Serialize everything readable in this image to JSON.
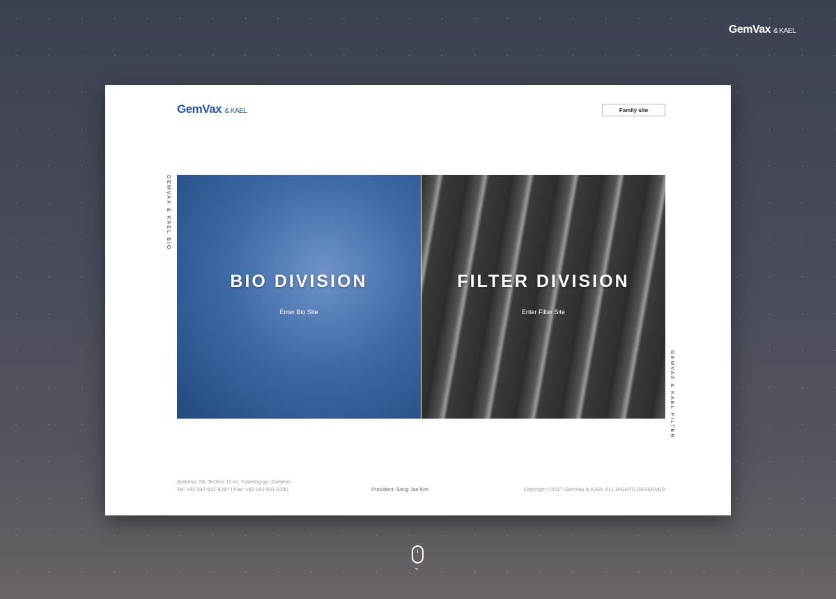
{
  "top_logo": {
    "brand": "GemVax",
    "suffix": "& KAEL"
  },
  "card": {
    "logo": {
      "brand": "GemVax",
      "suffix": "& KAEL"
    },
    "family_site": "Family site",
    "side_left": "GEMVAX & KAEL BIO",
    "side_right": "GEMVAX & KAEL FILTER",
    "bio": {
      "title": "BIO DIVISION",
      "link": "Enter Bio Site"
    },
    "filter": {
      "title": "FILTER DIVISION",
      "link": "Enter Filter Site"
    },
    "footer": {
      "address": "Address: 58, Techno 11-ro, Yuseong-gu, Daejeon",
      "contact": "Tel: +82 042-931-6287  I  Fax: +82 042-931-9190",
      "president": "President: Sang Jae Kim",
      "copyright": "Copyright ©2017 GemVax & KAEL ALL RIGHTS RESERVED"
    }
  },
  "scroll": {
    "chevron": "⌄"
  }
}
